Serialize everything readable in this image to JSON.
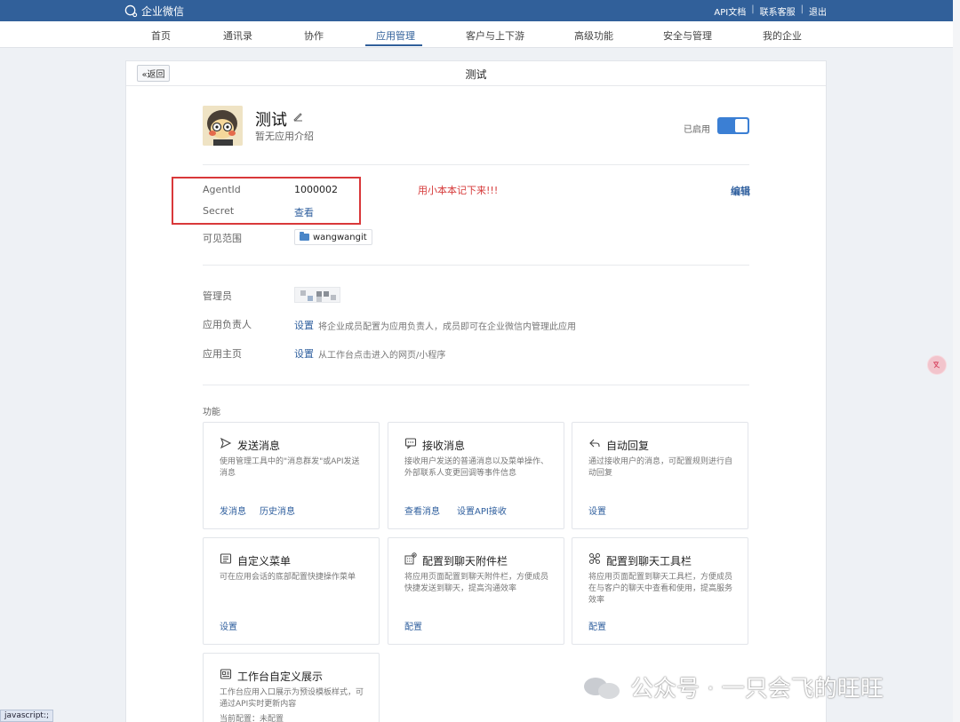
{
  "topbar": {
    "logo_text": "企业微信",
    "links": [
      "API文档",
      "联系客服",
      "退出"
    ]
  },
  "nav": {
    "items": [
      "首页",
      "通讯录",
      "协作",
      "应用管理",
      "客户与上下游",
      "高级功能",
      "安全与管理",
      "我的企业"
    ],
    "active": "应用管理"
  },
  "header": {
    "back_label": "«返回",
    "title": "测试"
  },
  "app": {
    "name": "测试",
    "description": "暂无应用介绍",
    "enabled_label": "已启用",
    "enabled": true
  },
  "credentials": {
    "agentid_label": "AgentId",
    "agentid_value": "1000002",
    "secret_label": "Secret",
    "secret_link": "查看",
    "note": "用小本本记下来!!!",
    "edit_link": "编辑",
    "visible_label": "可见范围",
    "visible_value": "wangwangit"
  },
  "settings": {
    "admin_label": "管理员",
    "owner_label": "应用负责人",
    "owner_link": "设置",
    "owner_desc": "将企业成员配置为应用负责人，成员即可在企业微信内管理此应用",
    "home_label": "应用主页",
    "home_link": "设置",
    "home_desc": "从工作台点击进入的网页/小程序"
  },
  "features": {
    "section_label": "功能",
    "cards": [
      {
        "icon": "send-icon",
        "title": "发送消息",
        "desc": "使用管理工具中的\"消息群发\"或API发送消息",
        "links": [
          "发消息",
          "历史消息"
        ]
      },
      {
        "icon": "receive-message-icon",
        "title": "接收消息",
        "desc": "接收用户发送的普通消息以及菜单操作、外部联系人变更回调等事件信息",
        "links": [
          "查看消息",
          "设置API接收"
        ]
      },
      {
        "icon": "auto-reply-icon",
        "title": "自动回复",
        "desc": "通过接收用户的消息，可配置规则进行自动回复",
        "links": [
          "设置"
        ]
      },
      {
        "icon": "menu-icon",
        "title": "自定义菜单",
        "desc": "可在应用会话的底部配置快捷操作菜单",
        "links": [
          "设置"
        ]
      },
      {
        "icon": "attachment-bar-icon",
        "title": "配置到聊天附件栏",
        "desc": "将应用页面配置到聊天附件栏，方便成员快捷发送到聊天，提高沟通效率",
        "links": [
          "配置"
        ]
      },
      {
        "icon": "toolbar-icon",
        "title": "配置到聊天工具栏",
        "desc": "将应用页面配置到聊天工具栏，方便成员在与客户的聊天中查看和使用，提高服务效率",
        "links": [
          "配置"
        ]
      },
      {
        "icon": "workbench-icon",
        "title": "工作台自定义展示",
        "desc": "工作台应用入口展示为预设模板样式，可通过API实时更新内容",
        "links": [],
        "extra": "当前配置：未配置"
      }
    ]
  },
  "watermark": "公众号 · 一只会飞的旺旺",
  "status_bar": "javascript:;"
}
